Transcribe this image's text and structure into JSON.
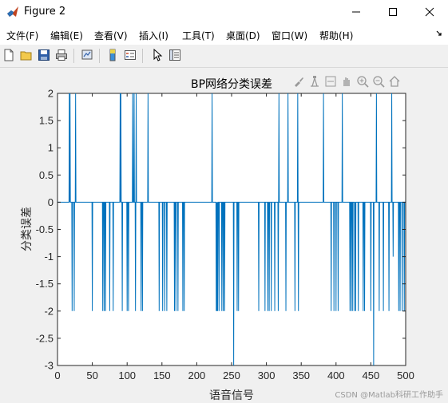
{
  "window": {
    "title": "Figure 2"
  },
  "menu": {
    "items": [
      "文件(F)",
      "编辑(E)",
      "查看(V)",
      "插入(I)",
      "工具(T)",
      "桌面(D)",
      "窗口(W)",
      "帮助(H)"
    ]
  },
  "toolbar": {
    "icons": [
      "new-figure-icon",
      "open-file-icon",
      "save-icon",
      "print-icon",
      "link-plot-icon",
      "insert-colorbar-icon",
      "insert-legend-icon",
      "edit-plot-icon",
      "property-inspector-icon"
    ]
  },
  "axes_toolbar": {
    "icons": [
      "brush-icon",
      "data-tips-icon",
      "rotate-icon",
      "pan-icon",
      "zoom-in-icon",
      "zoom-out-icon",
      "home-icon"
    ]
  },
  "watermark": "CSDN @Matlab科研工作助手",
  "colors": {
    "line": "#0072bd",
    "axes_bg": "#ffffff",
    "figure_bg": "#f0f0f0"
  },
  "chart_data": {
    "type": "line",
    "title": "BP网络分类误差",
    "xlabel": "语音信号",
    "ylabel": "分类误差",
    "xlim": [
      0,
      500
    ],
    "ylim": [
      -3,
      2
    ],
    "xticks": [
      0,
      50,
      100,
      150,
      200,
      250,
      300,
      350,
      400,
      450,
      500
    ],
    "yticks": [
      -3,
      -2.5,
      -2,
      -1.5,
      -1,
      -0.5,
      0,
      0.5,
      1,
      1.5,
      2
    ],
    "ytick_labels": [
      "-3",
      "-2.5",
      "-2",
      "-1.5",
      "-1",
      "-0.5",
      "0",
      "0.5",
      "1",
      "1.5",
      "2"
    ],
    "grid": false,
    "series": [
      {
        "spikes": [
          [
            17,
            2
          ],
          [
            18,
            2
          ],
          [
            21,
            -2
          ],
          [
            24,
            -2
          ],
          [
            26,
            2
          ],
          [
            50,
            -2
          ],
          [
            65,
            -2
          ],
          [
            67,
            -2
          ],
          [
            69,
            -2
          ],
          [
            75,
            -2
          ],
          [
            80,
            -2
          ],
          [
            90,
            2
          ],
          [
            91,
            2
          ],
          [
            93,
            -2
          ],
          [
            100,
            -2
          ],
          [
            102,
            -2
          ],
          [
            108,
            2
          ],
          [
            110,
            2
          ],
          [
            112,
            -2
          ],
          [
            113,
            2
          ],
          [
            120,
            -2
          ],
          [
            122,
            -2
          ],
          [
            130,
            2
          ],
          [
            146,
            -2
          ],
          [
            151,
            -2
          ],
          [
            154,
            -2
          ],
          [
            157,
            -2
          ],
          [
            168,
            -2
          ],
          [
            170,
            -2
          ],
          [
            173,
            -2
          ],
          [
            180,
            -2
          ],
          [
            182,
            -2
          ],
          [
            222,
            2
          ],
          [
            228,
            -2
          ],
          [
            229,
            -2
          ],
          [
            230,
            -2
          ],
          [
            232,
            -2
          ],
          [
            236,
            -2
          ],
          [
            238,
            -2
          ],
          [
            240,
            -2
          ],
          [
            253,
            -3
          ],
          [
            258,
            -2
          ],
          [
            260,
            -2
          ],
          [
            289,
            -2
          ],
          [
            298,
            -2
          ],
          [
            302,
            -2
          ],
          [
            304,
            -2
          ],
          [
            307,
            -2
          ],
          [
            312,
            -2
          ],
          [
            317,
            -2
          ],
          [
            318,
            2
          ],
          [
            328,
            -2
          ],
          [
            331,
            2
          ],
          [
            341,
            -2
          ],
          [
            345,
            2
          ],
          [
            346,
            -2
          ],
          [
            382,
            2
          ],
          [
            393,
            -2
          ],
          [
            397,
            -2
          ],
          [
            400,
            -2
          ],
          [
            403,
            -2
          ],
          [
            409,
            2
          ],
          [
            420,
            -2
          ],
          [
            422,
            -2
          ],
          [
            424,
            -2
          ],
          [
            427,
            -2
          ],
          [
            428,
            -2
          ],
          [
            432,
            -2
          ],
          [
            439,
            -2
          ],
          [
            441,
            -2
          ],
          [
            450,
            -2
          ],
          [
            454,
            -3
          ],
          [
            458,
            2
          ],
          [
            462,
            -2
          ],
          [
            468,
            -2
          ],
          [
            476,
            -2
          ],
          [
            480,
            2
          ],
          [
            482,
            -1
          ],
          [
            490,
            -2
          ],
          [
            492,
            -2
          ],
          [
            495,
            -2
          ],
          [
            498,
            -2
          ]
        ],
        "baseline": 0
      }
    ]
  }
}
